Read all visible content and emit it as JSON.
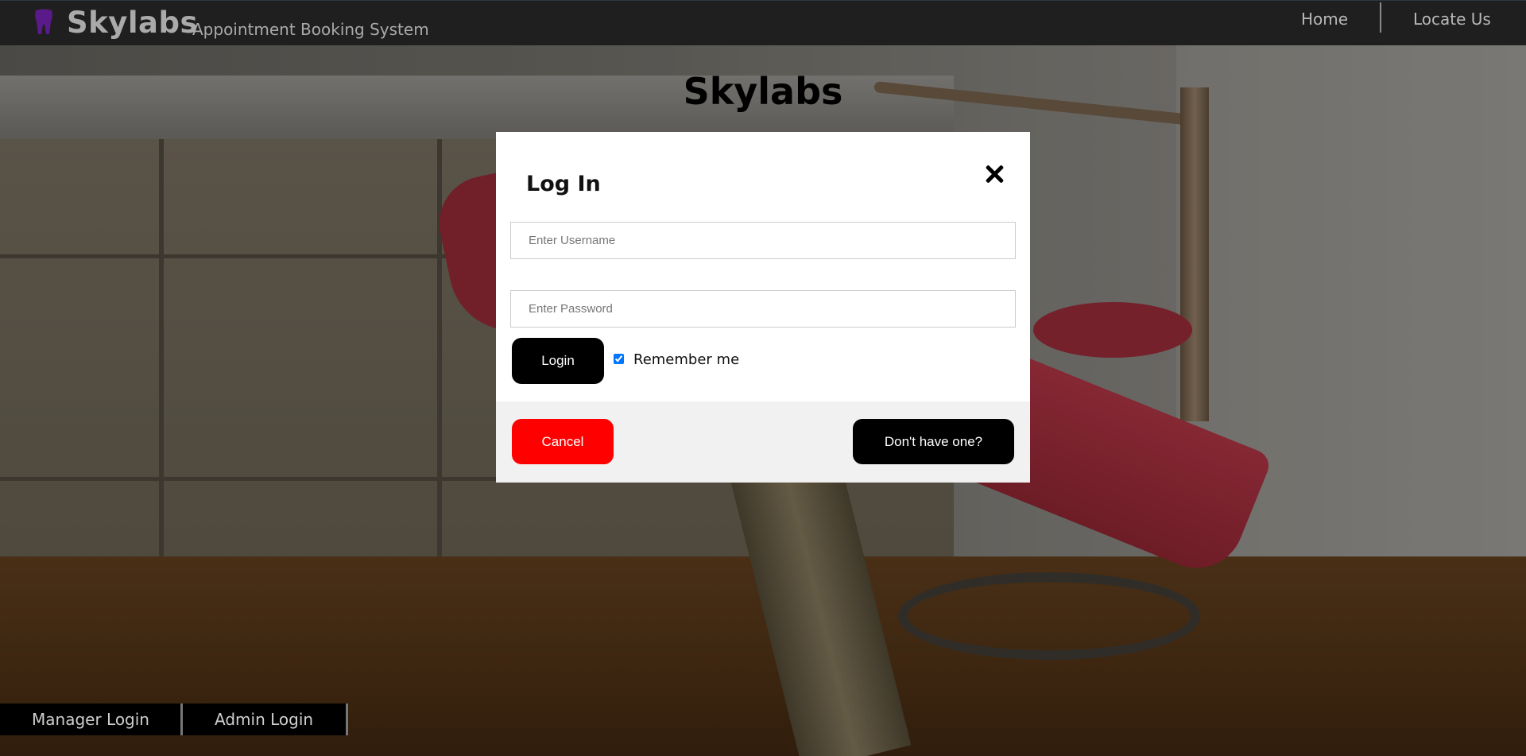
{
  "header": {
    "logo_icon": "tooth-icon",
    "brand": "Skylabs",
    "subtitle": "Appointment Booking System",
    "nav": {
      "home": "Home",
      "locate": "Locate Us"
    }
  },
  "page": {
    "heading": "Skylabs"
  },
  "modal": {
    "title": "Log In",
    "close_icon": "close-icon",
    "username_placeholder": "Enter Username",
    "password_placeholder": "Enter Password",
    "login_label": "Login",
    "remember_label": "Remember me",
    "remember_checked": true,
    "cancel_label": "Cancel",
    "signup_label": "Don't have one?"
  },
  "footer_links": {
    "manager": "Manager Login",
    "admin": "Admin Login"
  },
  "colors": {
    "navbar": "#1f1f1f",
    "logo": "#5b1a8a",
    "cancel": "#ff0000",
    "primary_button": "#000000"
  }
}
